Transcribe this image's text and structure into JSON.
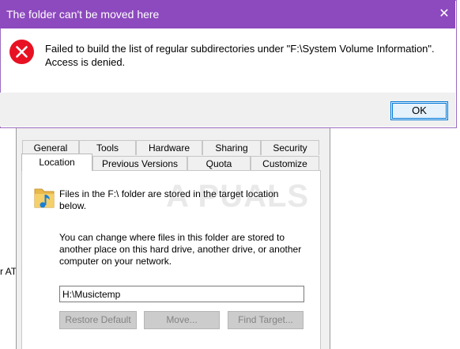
{
  "dialog": {
    "title": "The folder can't be moved here",
    "message_line1": "Failed to build the list of regular subdirectories under \"F:\\System Volume Information\".",
    "message_line2": "Access is denied.",
    "ok_label": "OK",
    "close_glyph": "✕",
    "accent_color": "#8d49be"
  },
  "properties": {
    "tabs_row1": [
      "General",
      "Tools",
      "Hardware",
      "Sharing",
      "Security"
    ],
    "tabs_row2": [
      "Location",
      "Previous Versions",
      "Quota",
      "Customize"
    ],
    "active_tab": "Location",
    "info_line1": "Files in the F:\\ folder are stored in the target location",
    "info_line2": "below.",
    "desc_line1": "You can change where files in this folder are stored to",
    "desc_line2": "another place on this hard drive, another drive, or another",
    "desc_line3": "computer on your network.",
    "path_value": "H:\\Musictemp",
    "restore_default_label": "Restore Default",
    "move_label": "Move...",
    "find_target_label": "Find Target..."
  },
  "left_fragment": "r AT",
  "watermark": "A PUALS",
  "icons": [
    "error-icon",
    "close-icon",
    "music-folder-icon"
  ]
}
